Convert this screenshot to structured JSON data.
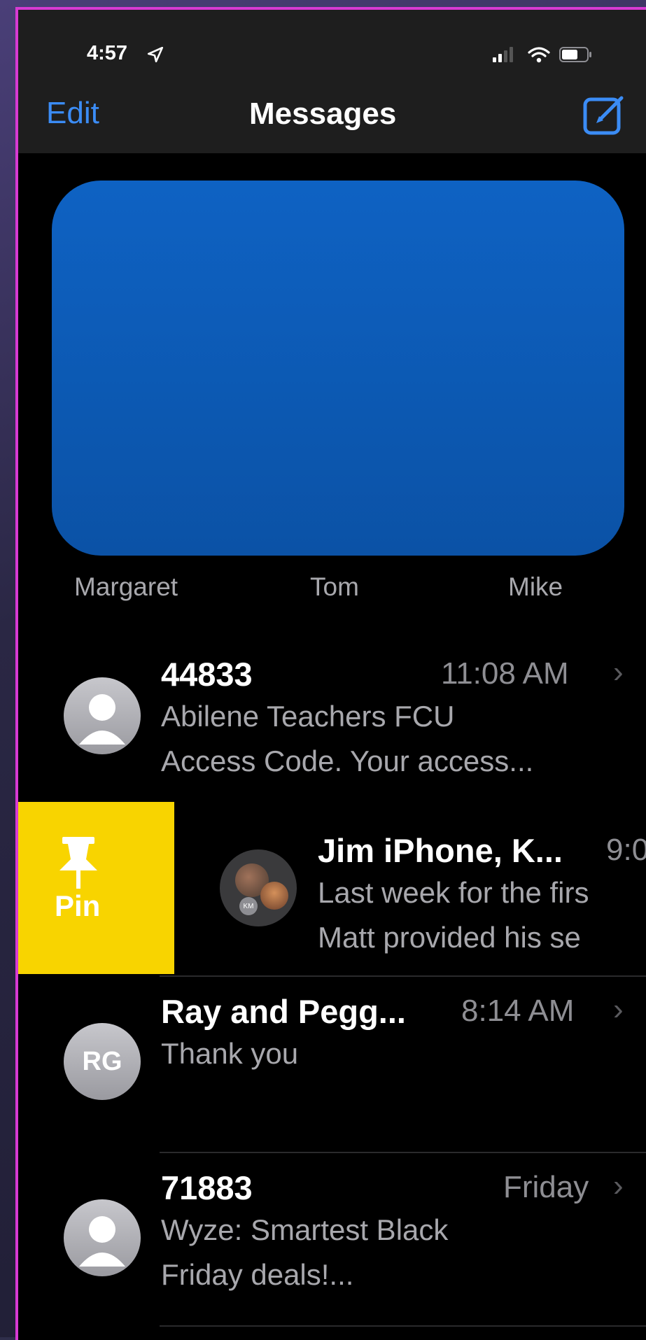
{
  "status_bar": {
    "time": "4:57"
  },
  "nav": {
    "edit_label": "Edit",
    "title": "Messages"
  },
  "pinned": [
    {
      "name": "Margaret"
    },
    {
      "name": "Tom"
    },
    {
      "name": "Mike"
    }
  ],
  "swipe_action": {
    "label": "Pin",
    "color": "#f8d400"
  },
  "conversations": [
    {
      "title": "44833",
      "time": "11:08 AM",
      "preview_line1": "Abilene Teachers FCU",
      "preview_line2": "Access Code. Your access..."
    },
    {
      "title": "Jim iPhone, K...",
      "time": "9:0",
      "preview_line1": "Last week for the firs",
      "preview_line2": "Matt provided his se",
      "avatar_badge": "KM"
    },
    {
      "title": "Ray and Pegg...",
      "time": "8:14 AM",
      "preview_line1": "Thank you",
      "avatar_initials": "RG"
    },
    {
      "title": "71883",
      "time": "Friday",
      "preview_line1": "Wyze: Smartest Black",
      "preview_line2": "Friday deals!..."
    }
  ],
  "colors": {
    "accent": "#3b8cf5",
    "background": "#000000",
    "pin_yellow": "#f8d400"
  }
}
